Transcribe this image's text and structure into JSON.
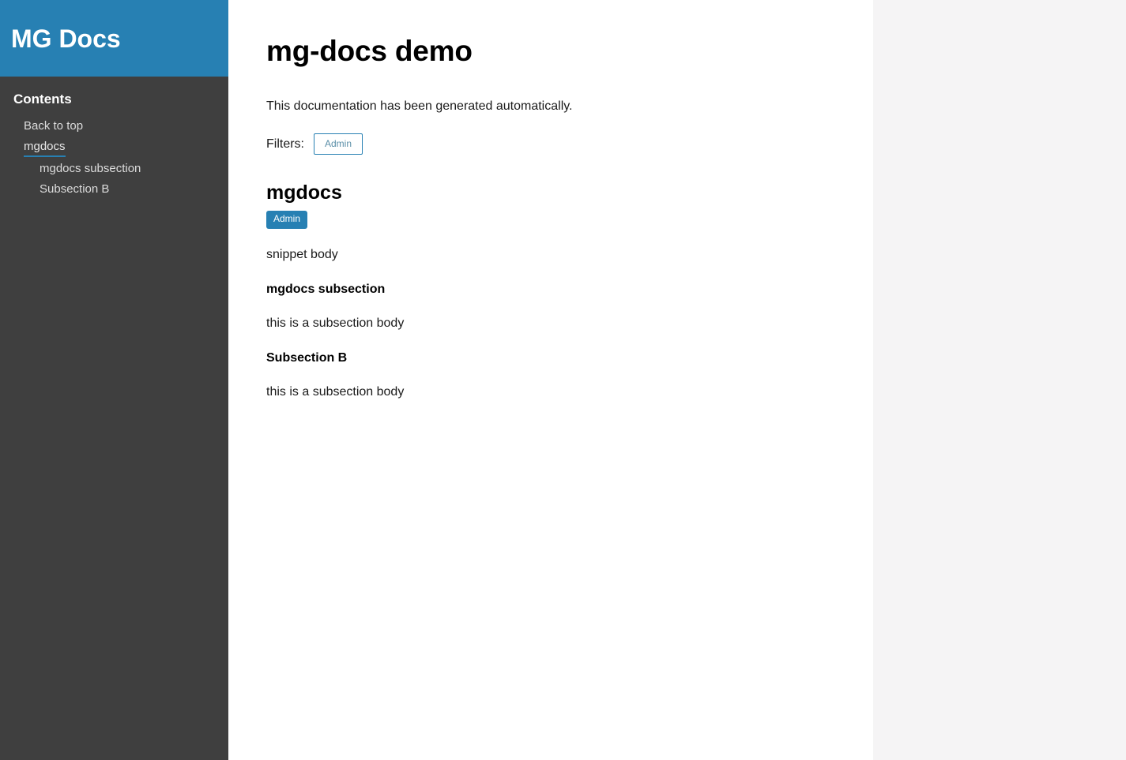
{
  "sidebar": {
    "brand": "MG Docs",
    "contents_heading": "Contents",
    "items": [
      {
        "label": "Back to top",
        "active": false,
        "level": 1
      },
      {
        "label": "mgdocs",
        "active": true,
        "level": 1
      },
      {
        "label": "mgdocs subsection",
        "active": false,
        "level": 2
      },
      {
        "label": "Subsection B",
        "active": false,
        "level": 2
      }
    ]
  },
  "main": {
    "title": "mg-docs demo",
    "intro": "This documentation has been generated automatically.",
    "filters_label": "Filters:",
    "filter_buttons": [
      {
        "label": "Admin"
      }
    ],
    "sections": [
      {
        "heading": "mgdocs",
        "badge": "Admin",
        "body": "snippet body",
        "subsections": [
          {
            "heading": "mgdocs subsection",
            "body": "this is a subsection body"
          },
          {
            "heading": "Subsection B",
            "body": "this is a subsection body"
          }
        ]
      }
    ]
  },
  "colors": {
    "brand_blue": "#2780b3",
    "sidebar_dark": "#3f3f3f",
    "page_background": "#f5f4f5",
    "content_background": "#ffffff",
    "badge_text": "#ffffff",
    "filter_text": "#5b8fa8"
  }
}
